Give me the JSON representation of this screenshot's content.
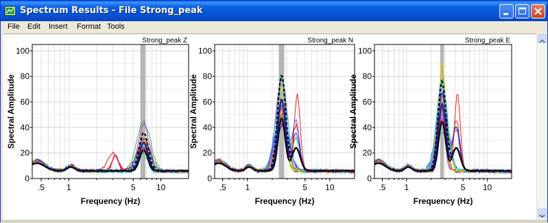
{
  "window": {
    "title": "Spectrum Results - File Strong_peak",
    "buttons": [
      "minimize-icon",
      "maximize-icon",
      "close-icon"
    ]
  },
  "menu": [
    "File",
    "Edit",
    "Insert",
    "Format",
    "Tools"
  ],
  "chart_data": [
    {
      "type": "line",
      "title": "Strong_peak Z",
      "xlabel": "Frequency (Hz)",
      "ylabel": "Spectral Amplitude",
      "xscale": "log",
      "xlim": [
        0.4,
        20
      ],
      "ylim": [
        0,
        105
      ],
      "xticks": [
        ".5",
        "1",
        "5",
        "10"
      ],
      "yticks": [
        "0",
        "20",
        "40",
        "60",
        "80",
        "100"
      ],
      "highlight_band_hz": [
        6.0,
        6.8
      ],
      "mean_peak_hz": 6.5,
      "mean_peak_amplitude": 30
    },
    {
      "type": "line",
      "title": "Strong_peak N",
      "xlabel": "Frequency (Hz)",
      "ylabel": "Spectral Amplitude",
      "xscale": "log",
      "xlim": [
        0.4,
        20
      ],
      "ylim": [
        0,
        105
      ],
      "xticks": [
        ".5",
        "1",
        "5",
        "10"
      ],
      "yticks": [
        "0",
        "20",
        "40",
        "60",
        "80",
        "100"
      ],
      "highlight_band_hz": [
        2.4,
        2.8
      ],
      "mean_peak_hz": 2.6,
      "mean_peak_amplitude": 75
    },
    {
      "type": "line",
      "title": "Strong_peak E",
      "xlabel": "Frequency (Hz)",
      "ylabel": "Spectral Amplitude",
      "xscale": "log",
      "xlim": [
        0.4,
        20
      ],
      "ylim": [
        0,
        105
      ],
      "xticks": [
        ".5",
        "1",
        "5",
        "10"
      ],
      "yticks": [
        "0",
        "20",
        "40",
        "60",
        "80",
        "100"
      ],
      "highlight_band_hz": [
        2.6,
        2.9
      ],
      "mean_peak_hz": 2.75,
      "mean_peak_amplitude": 70
    }
  ],
  "colors": {
    "titlebar": "#0a5fd8",
    "mean_curve": "#000000",
    "band": "#a0a0a0",
    "series": [
      "#e8201a",
      "#f0e000",
      "#1a20c8",
      "#28c8e0",
      "#20c040",
      "#c020c0",
      "#40e0a0",
      "#f08020",
      "#6060ff",
      "#00a0a0"
    ]
  }
}
